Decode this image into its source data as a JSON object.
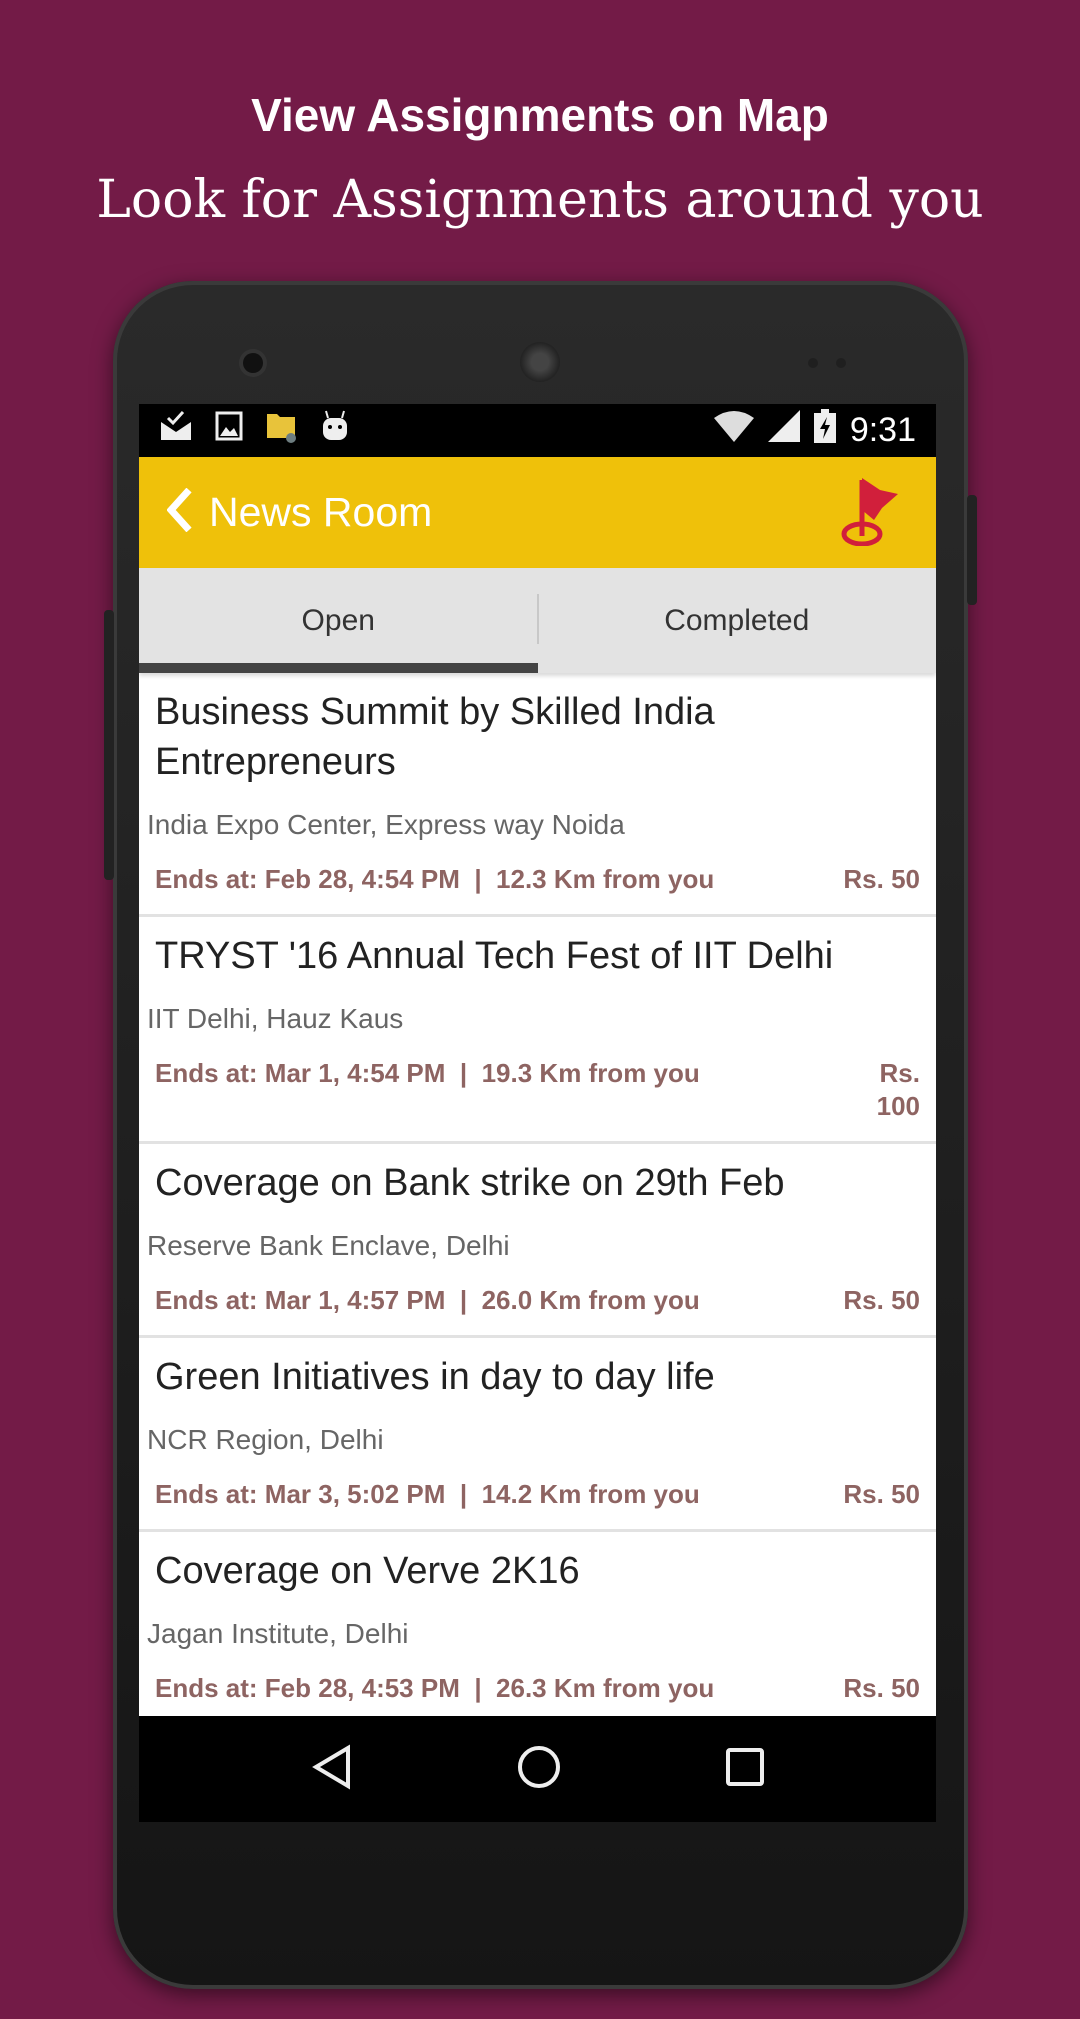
{
  "promo": {
    "headline": "View Assignments on Map",
    "subline": "Look for Assignments around you"
  },
  "status_bar": {
    "icons": [
      "mail-check-icon",
      "image-icon",
      "folder-settings-icon",
      "android-icon"
    ],
    "time": "9:31"
  },
  "app_bar": {
    "title": "News Room",
    "back_icon": "chevron-left-icon",
    "action_icon": "map-flag-icon",
    "accent": "#efc10a"
  },
  "tabs": [
    {
      "label": "Open",
      "active": true
    },
    {
      "label": "Completed",
      "active": false
    }
  ],
  "assignments": [
    {
      "title": "Business Summit by Skilled India Entrepreneurs",
      "address": "India Expo Center, Express way Noida",
      "ends": "Ends at: Feb 28, 4:54 PM  |  12.3 Km from you",
      "price": "Rs. 50"
    },
    {
      "title": "TRYST '16 Annual Tech Fest of IIT Delhi",
      "address": "IIT Delhi, Hauz Kaus",
      "ends": "Ends at: Mar 1, 4:54 PM  |  19.3 Km from you",
      "price": "Rs. 100"
    },
    {
      "title": "Coverage on Bank strike on 29th Feb",
      "address": "Reserve Bank Enclave, Delhi",
      "ends": "Ends at: Mar 1, 4:57 PM  |  26.0 Km from you",
      "price": "Rs. 50"
    },
    {
      "title": "Green Initiatives in day to day life",
      "address": "NCR Region, Delhi",
      "ends": "Ends at: Mar 3, 5:02 PM  |  14.2 Km from you",
      "price": "Rs. 50"
    },
    {
      "title": "Coverage on Verve 2K16",
      "address": "Jagan Institute, Delhi",
      "ends": "Ends at: Feb 28, 4:53 PM  |  26.3 Km from you",
      "price": "Rs. 50"
    }
  ],
  "colors": {
    "background": "#731b47",
    "meta": "#8e6462"
  }
}
